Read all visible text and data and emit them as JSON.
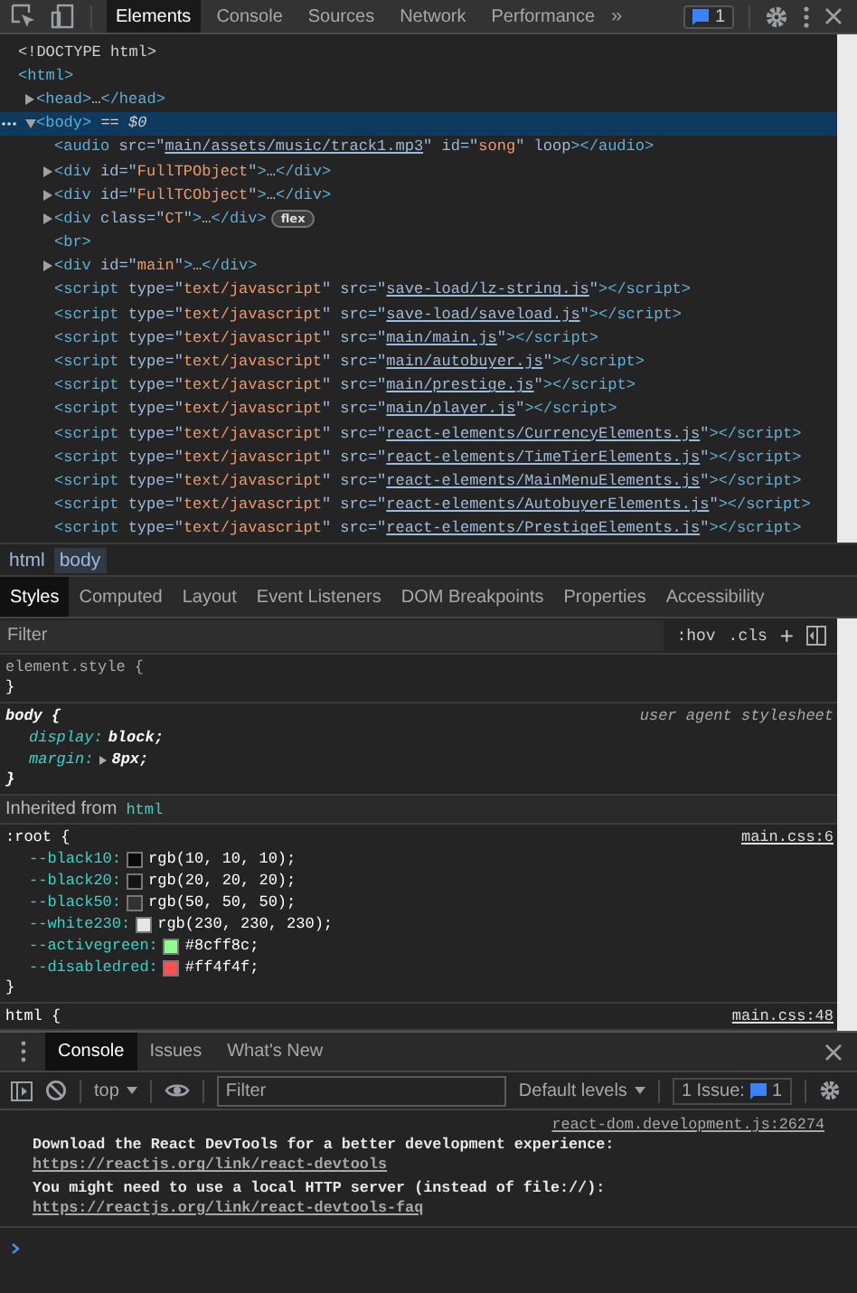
{
  "toolbar": {
    "tabs": [
      {
        "label": "Elements",
        "selected": true
      },
      {
        "label": "Console",
        "selected": false
      },
      {
        "label": "Sources",
        "selected": false
      },
      {
        "label": "Network",
        "selected": false
      },
      {
        "label": "Performance",
        "selected": false
      }
    ],
    "more": "»",
    "issues_count": "1"
  },
  "dom_tree": [
    {
      "parts": [
        {
          "kind": "text",
          "text": "<!DOCTYPE html>"
        }
      ],
      "selected": false
    },
    {
      "parts": [
        {
          "kind": "tag",
          "text": "<html>"
        }
      ],
      "selected": false,
      "children": [
        {
          "parts": [
            {
              "kind": "tag",
              "text": "<head>"
            },
            {
              "kind": "text",
              "text": "…"
            },
            {
              "kind": "tag",
              "text": "</head>"
            }
          ],
          "expanded": false,
          "selected": false
        },
        {
          "parts": [
            {
              "kind": "tag",
              "text": "<body>"
            },
            {
              "kind": "meta",
              "text": " == $0"
            }
          ],
          "expanded": true,
          "selected": true,
          "children": [
            {
              "parts": [
                {
                  "kind": "tag",
                  "text": "<audio"
                },
                {
                  "kind": "attr",
                  "text": " src=\""
                },
                {
                  "kind": "link",
                  "text": "main/assets/music/track1.mp3"
                },
                {
                  "kind": "attr",
                  "text": "\" id=\""
                },
                {
                  "kind": "value",
                  "text": "song"
                },
                {
                  "kind": "attr",
                  "text": "\" loop"
                },
                {
                  "kind": "tag",
                  "text": "></audio>"
                }
              ],
              "selected": false
            },
            {
              "parts": [
                {
                  "kind": "tag",
                  "text": "<div"
                },
                {
                  "kind": "attr",
                  "text": " id=\""
                },
                {
                  "kind": "value",
                  "text": "FullTPObject"
                },
                {
                  "kind": "attr",
                  "text": "\""
                },
                {
                  "kind": "tag",
                  "text": ">"
                },
                {
                  "kind": "text",
                  "text": "…"
                },
                {
                  "kind": "tag",
                  "text": "</div>"
                }
              ],
              "expanded": false,
              "selected": false
            },
            {
              "parts": [
                {
                  "kind": "tag",
                  "text": "<div"
                },
                {
                  "kind": "attr",
                  "text": " id=\""
                },
                {
                  "kind": "value",
                  "text": "FullTCObject"
                },
                {
                  "kind": "attr",
                  "text": "\""
                },
                {
                  "kind": "tag",
                  "text": ">"
                },
                {
                  "kind": "text",
                  "text": "…"
                },
                {
                  "kind": "tag",
                  "text": "</div>"
                }
              ],
              "expanded": false,
              "selected": false
            },
            {
              "parts": [
                {
                  "kind": "tag",
                  "text": "<div"
                },
                {
                  "kind": "attr",
                  "text": " class=\""
                },
                {
                  "kind": "value",
                  "text": "CT"
                },
                {
                  "kind": "attr",
                  "text": "\""
                },
                {
                  "kind": "tag",
                  "text": ">"
                },
                {
                  "kind": "text",
                  "text": "…"
                },
                {
                  "kind": "tag",
                  "text": "</div>"
                }
              ],
              "expanded": false,
              "selected": false,
              "badge": "flex"
            },
            {
              "parts": [
                {
                  "kind": "tag",
                  "text": "<br>"
                }
              ],
              "selected": false
            },
            {
              "parts": [
                {
                  "kind": "tag",
                  "text": "<div"
                },
                {
                  "kind": "attr",
                  "text": " id=\""
                },
                {
                  "kind": "value",
                  "text": "main"
                },
                {
                  "kind": "attr",
                  "text": "\""
                },
                {
                  "kind": "tag",
                  "text": ">"
                },
                {
                  "kind": "text",
                  "text": "…"
                },
                {
                  "kind": "tag",
                  "text": "</div>"
                }
              ],
              "expanded": false,
              "selected": false
            },
            {
              "parts": [
                {
                  "kind": "tag",
                  "text": "<script"
                },
                {
                  "kind": "attr",
                  "text": " type=\""
                },
                {
                  "kind": "value",
                  "text": "text/javascript"
                },
                {
                  "kind": "attr",
                  "text": "\" src=\""
                },
                {
                  "kind": "link",
                  "text": "save-load/lz-string.js"
                },
                {
                  "kind": "attr",
                  "text": "\""
                },
                {
                  "kind": "tag",
                  "text": "></script>"
                }
              ],
              "selected": false
            },
            {
              "parts": [
                {
                  "kind": "tag",
                  "text": "<script"
                },
                {
                  "kind": "attr",
                  "text": " type=\""
                },
                {
                  "kind": "value",
                  "text": "text/javascript"
                },
                {
                  "kind": "attr",
                  "text": "\" src=\""
                },
                {
                  "kind": "link",
                  "text": "save-load/saveload.js"
                },
                {
                  "kind": "attr",
                  "text": "\""
                },
                {
                  "kind": "tag",
                  "text": "></script>"
                }
              ],
              "selected": false
            },
            {
              "parts": [
                {
                  "kind": "tag",
                  "text": "<script"
                },
                {
                  "kind": "attr",
                  "text": " type=\""
                },
                {
                  "kind": "value",
                  "text": "text/javascript"
                },
                {
                  "kind": "attr",
                  "text": "\" src=\""
                },
                {
                  "kind": "link",
                  "text": "main/main.js"
                },
                {
                  "kind": "attr",
                  "text": "\""
                },
                {
                  "kind": "tag",
                  "text": "></script>"
                }
              ],
              "selected": false
            },
            {
              "parts": [
                {
                  "kind": "tag",
                  "text": "<script"
                },
                {
                  "kind": "attr",
                  "text": " type=\""
                },
                {
                  "kind": "value",
                  "text": "text/javascript"
                },
                {
                  "kind": "attr",
                  "text": "\" src=\""
                },
                {
                  "kind": "link",
                  "text": "main/autobuyer.js"
                },
                {
                  "kind": "attr",
                  "text": "\""
                },
                {
                  "kind": "tag",
                  "text": "></script>"
                }
              ],
              "selected": false
            },
            {
              "parts": [
                {
                  "kind": "tag",
                  "text": "<script"
                },
                {
                  "kind": "attr",
                  "text": " type=\""
                },
                {
                  "kind": "value",
                  "text": "text/javascript"
                },
                {
                  "kind": "attr",
                  "text": "\" src=\""
                },
                {
                  "kind": "link",
                  "text": "main/prestige.js"
                },
                {
                  "kind": "attr",
                  "text": "\""
                },
                {
                  "kind": "tag",
                  "text": "></script>"
                }
              ],
              "selected": false
            },
            {
              "parts": [
                {
                  "kind": "tag",
                  "text": "<script"
                },
                {
                  "kind": "attr",
                  "text": " type=\""
                },
                {
                  "kind": "value",
                  "text": "text/javascript"
                },
                {
                  "kind": "attr",
                  "text": "\" src=\""
                },
                {
                  "kind": "link",
                  "text": "main/player.js"
                },
                {
                  "kind": "attr",
                  "text": "\""
                },
                {
                  "kind": "tag",
                  "text": "></script>"
                }
              ],
              "selected": false
            },
            {
              "parts": [
                {
                  "kind": "tag",
                  "text": "<script"
                },
                {
                  "kind": "attr",
                  "text": " type=\""
                },
                {
                  "kind": "value",
                  "text": "text/javascript"
                },
                {
                  "kind": "attr",
                  "text": "\" src=\""
                },
                {
                  "kind": "link",
                  "text": "react-elements/CurrencyElements.js"
                },
                {
                  "kind": "attr",
                  "text": "\""
                },
                {
                  "kind": "tag",
                  "text": "></script>"
                }
              ],
              "selected": false
            },
            {
              "parts": [
                {
                  "kind": "tag",
                  "text": "<script"
                },
                {
                  "kind": "attr",
                  "text": " type=\""
                },
                {
                  "kind": "value",
                  "text": "text/javascript"
                },
                {
                  "kind": "attr",
                  "text": "\" src=\""
                },
                {
                  "kind": "link",
                  "text": "react-elements/TimeTierElements.js"
                },
                {
                  "kind": "attr",
                  "text": "\""
                },
                {
                  "kind": "tag",
                  "text": "></script>"
                }
              ],
              "selected": false
            },
            {
              "parts": [
                {
                  "kind": "tag",
                  "text": "<script"
                },
                {
                  "kind": "attr",
                  "text": " type=\""
                },
                {
                  "kind": "value",
                  "text": "text/javascript"
                },
                {
                  "kind": "attr",
                  "text": "\" src=\""
                },
                {
                  "kind": "link",
                  "text": "react-elements/MainMenuElements.js"
                },
                {
                  "kind": "attr",
                  "text": "\""
                },
                {
                  "kind": "tag",
                  "text": "></script>"
                }
              ],
              "selected": false
            },
            {
              "parts": [
                {
                  "kind": "tag",
                  "text": "<script"
                },
                {
                  "kind": "attr",
                  "text": " type=\""
                },
                {
                  "kind": "value",
                  "text": "text/javascript"
                },
                {
                  "kind": "attr",
                  "text": "\" src=\""
                },
                {
                  "kind": "link",
                  "text": "react-elements/AutobuyerElements.js"
                },
                {
                  "kind": "attr",
                  "text": "\""
                },
                {
                  "kind": "tag",
                  "text": "></script>"
                }
              ],
              "selected": false
            },
            {
              "parts": [
                {
                  "kind": "tag",
                  "text": "<script"
                },
                {
                  "kind": "attr",
                  "text": " type=\""
                },
                {
                  "kind": "value",
                  "text": "text/javascript"
                },
                {
                  "kind": "attr",
                  "text": "\" src=\""
                },
                {
                  "kind": "link",
                  "text": "react-elements/PrestigeElements.js"
                },
                {
                  "kind": "attr",
                  "text": "\""
                },
                {
                  "kind": "tag",
                  "text": "></script>"
                }
              ],
              "selected": false
            }
          ]
        }
      ]
    }
  ],
  "breadcrumbs": [
    {
      "label": "html",
      "selected": false
    },
    {
      "label": "body",
      "selected": true
    }
  ],
  "styles_tabs": [
    {
      "label": "Styles",
      "selected": true
    },
    {
      "label": "Computed",
      "selected": false
    },
    {
      "label": "Layout",
      "selected": false
    },
    {
      "label": "Event Listeners",
      "selected": false
    },
    {
      "label": "DOM Breakpoints",
      "selected": false
    },
    {
      "label": "Properties",
      "selected": false
    },
    {
      "label": "Accessibility",
      "selected": false
    }
  ],
  "styles_filter": {
    "placeholder": "Filter",
    "hov": ":hov",
    "cls": ".cls",
    "add": "+"
  },
  "rules": [
    {
      "kind": "inline",
      "selector": "element.style {",
      "close": "}"
    },
    {
      "kind": "user_agent",
      "selector": "body {",
      "origin": "user agent stylesheet",
      "close": "}",
      "declarations": [
        {
          "name": "display:",
          "value": "block;"
        },
        {
          "name": "margin:",
          "value": "8px;",
          "expandable": true
        }
      ]
    },
    {
      "kind": "inherited",
      "label": "Inherited from",
      "link": "html"
    },
    {
      "kind": "author",
      "selector": ":root {",
      "source": "main.css:6",
      "close": "}",
      "declarations": [
        {
          "name": "--black10:",
          "value": "rgb(10, 10, 10);",
          "color": "#0a0a0a"
        },
        {
          "name": "--black20:",
          "value": "rgb(20, 20, 20);",
          "color": "#141414"
        },
        {
          "name": "--black50:",
          "value": "rgb(50, 50, 50);",
          "color": "#323232"
        },
        {
          "name": "--white230:",
          "value": "rgb(230, 230, 230);",
          "color": "#e6e6e6"
        },
        {
          "name": "--activegreen:",
          "value": "#8cff8c;",
          "color": "#8cff8c"
        },
        {
          "name": "--disabledred:",
          "value": "#ff4f4f;",
          "color": "#ff4f4f"
        }
      ]
    },
    {
      "kind": "author",
      "selector": "html {",
      "source": "main.css:48"
    }
  ],
  "drawer": {
    "tabs": [
      {
        "label": "Console",
        "selected": true
      },
      {
        "label": "Issues",
        "selected": false
      },
      {
        "label": "What's New",
        "selected": false
      }
    ]
  },
  "console": {
    "context": "top",
    "filter_placeholder": "Filter",
    "levels": "Default levels",
    "issues_label": "1 Issue:",
    "issues_count": "1",
    "source": "react-dom.development.js:26274",
    "messages": [
      {
        "text": "Download the React DevTools for a better development experience: ",
        "link": "https://reactjs.org/link/react-devtools"
      },
      {
        "text": "You might need to use a local HTTP server (instead of file://): ",
        "link": "https://reactjs.org/link/react-devtools-faq"
      }
    ]
  }
}
